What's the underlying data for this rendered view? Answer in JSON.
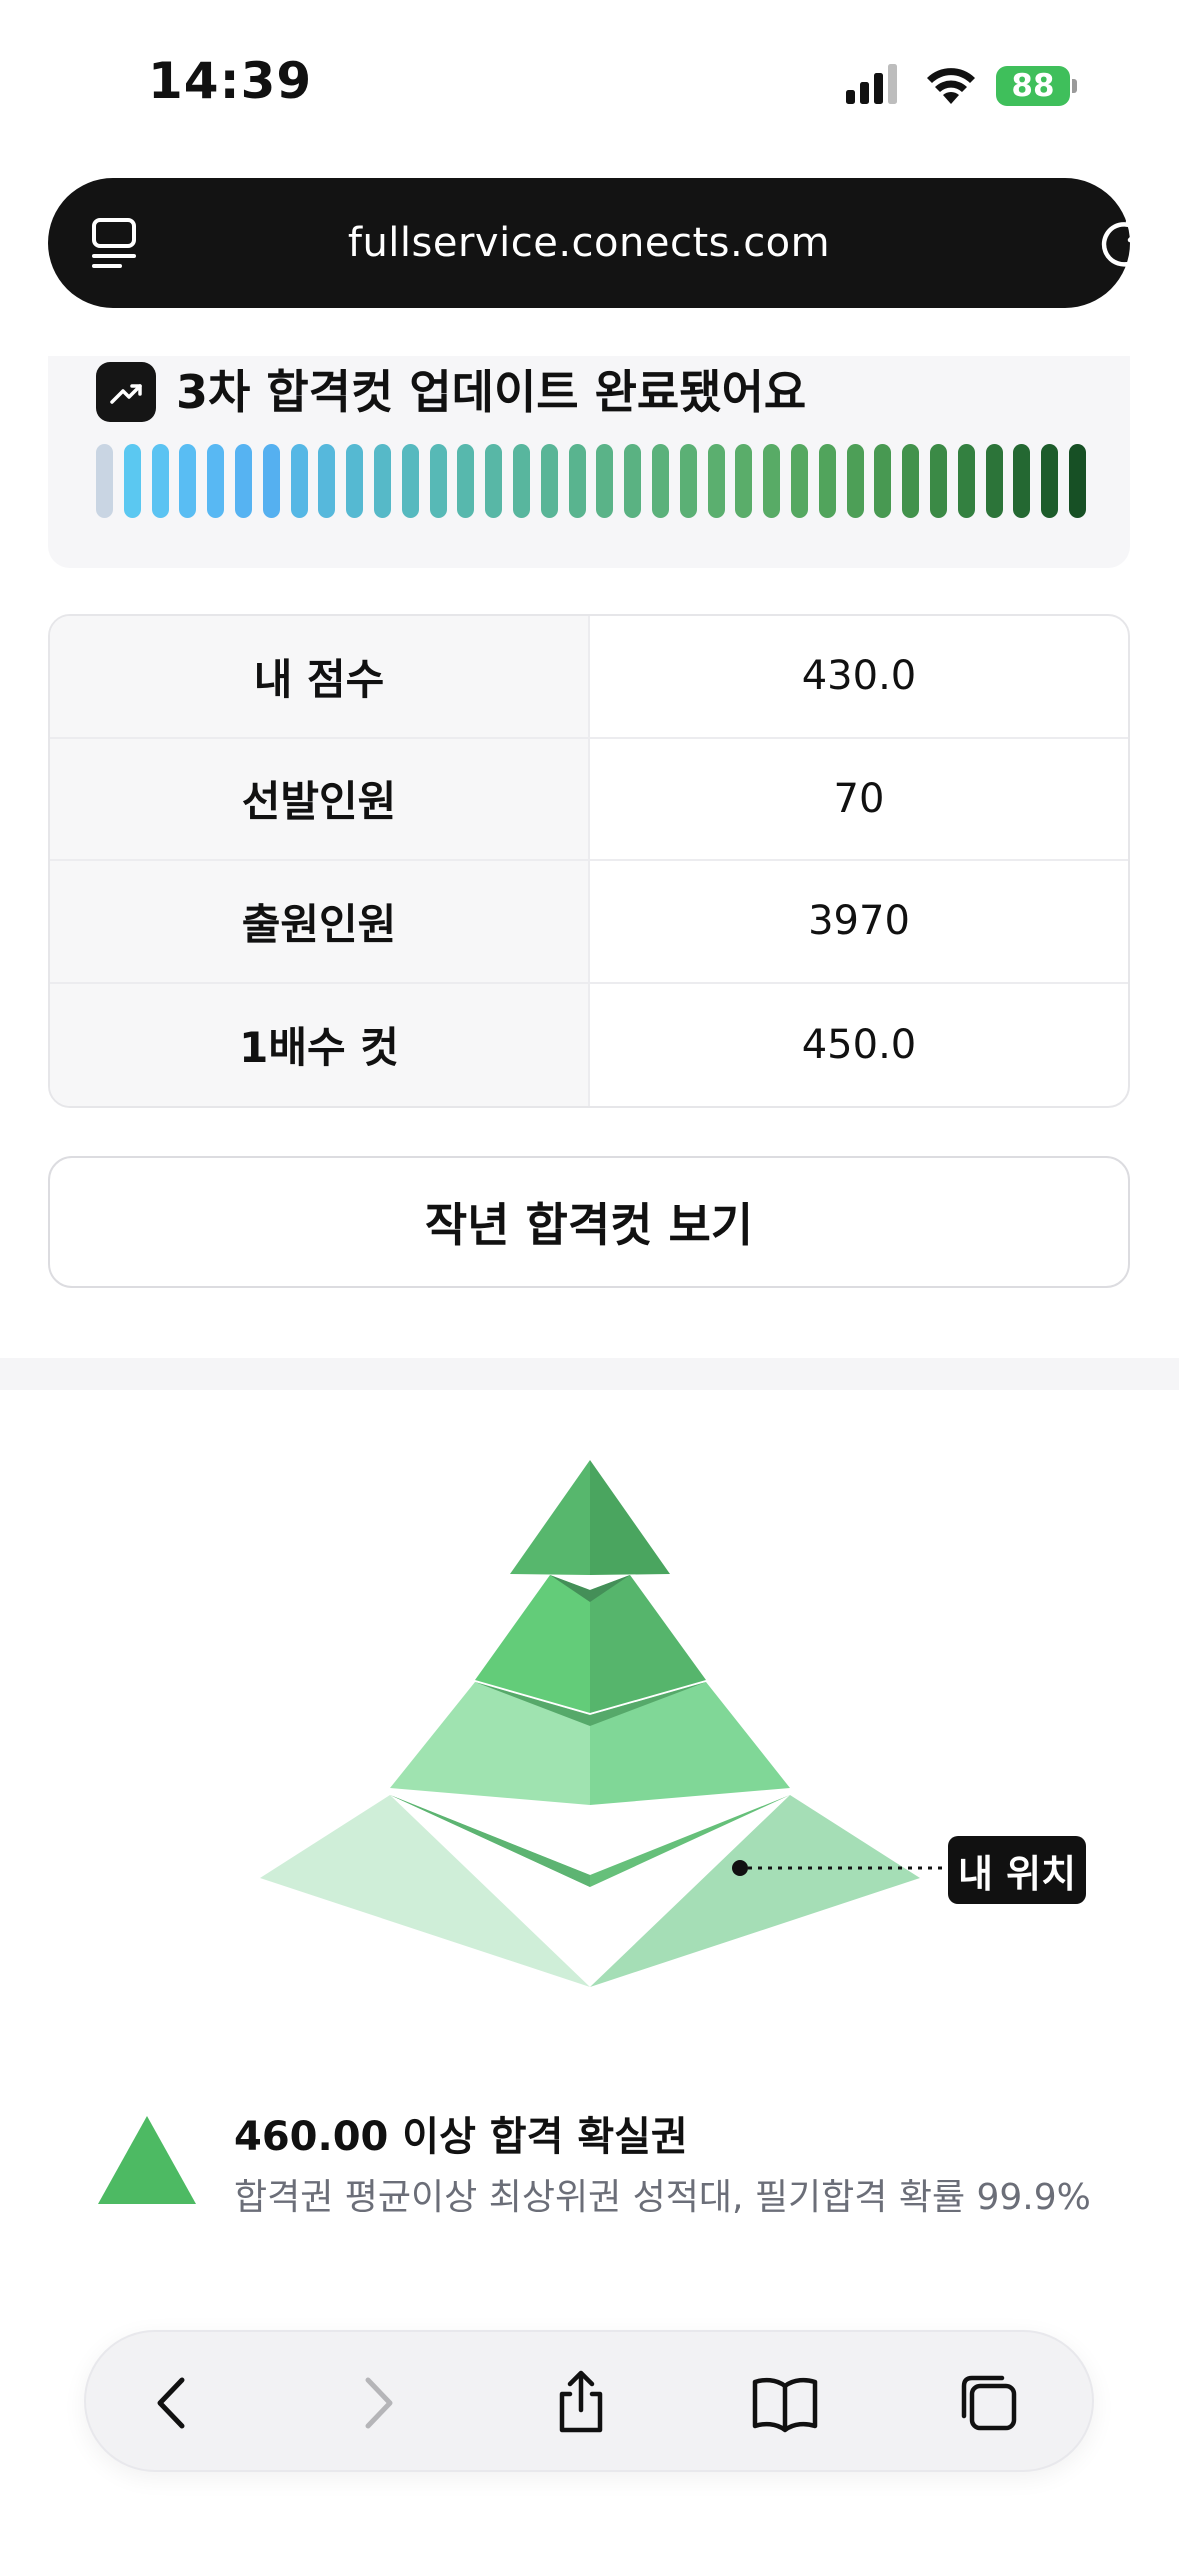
{
  "status_bar": {
    "time": "14:39",
    "battery": "88"
  },
  "browser": {
    "url": "fullservice.conects.com"
  },
  "update_card": {
    "title": "3차 합격컷 업데이트 완료됐어요",
    "colors": [
      "#c9d5e3",
      "#5bc8f1",
      "#5bc3f2",
      "#59bdf3",
      "#58b8f3",
      "#56b3f2",
      "#55b0f0",
      "#55b7e5",
      "#56b8dc",
      "#55b9d2",
      "#56b9c8",
      "#56b9bf",
      "#57b9b6",
      "#57b8ad",
      "#58b7a6",
      "#58b69e",
      "#59b597",
      "#59b48f",
      "#5ab388",
      "#5ab282",
      "#5bb17b",
      "#5bb075",
      "#5baf6f",
      "#5aad6a",
      "#58ab66",
      "#55a861",
      "#51a45c",
      "#4d9f57",
      "#489952",
      "#42924c",
      "#3b8a46",
      "#338040",
      "#2c7439",
      "#246832",
      "#1d5c2b",
      "#175025"
    ]
  },
  "info_table": {
    "rows": [
      {
        "label": "내 점수",
        "value": "430.0"
      },
      {
        "label": "선발인원",
        "value": "70"
      },
      {
        "label": "출원인원",
        "value": "3970"
      },
      {
        "label": "1배수 컷",
        "value": "450.0"
      }
    ]
  },
  "last_year_button": "작년 합격컷 보기",
  "pyramid": {
    "my_position_label": "내 위치"
  },
  "legend": {
    "title": "460.00 이상 합격 확실권",
    "description": "합격권 평균이상 최상위권 성적대, 필기합격 확률 99.9%",
    "color": "#4dba63"
  },
  "toolbar": {
    "icons": [
      "back-icon",
      "forward-icon",
      "share-icon",
      "bookmarks-icon",
      "tabs-icon"
    ]
  }
}
